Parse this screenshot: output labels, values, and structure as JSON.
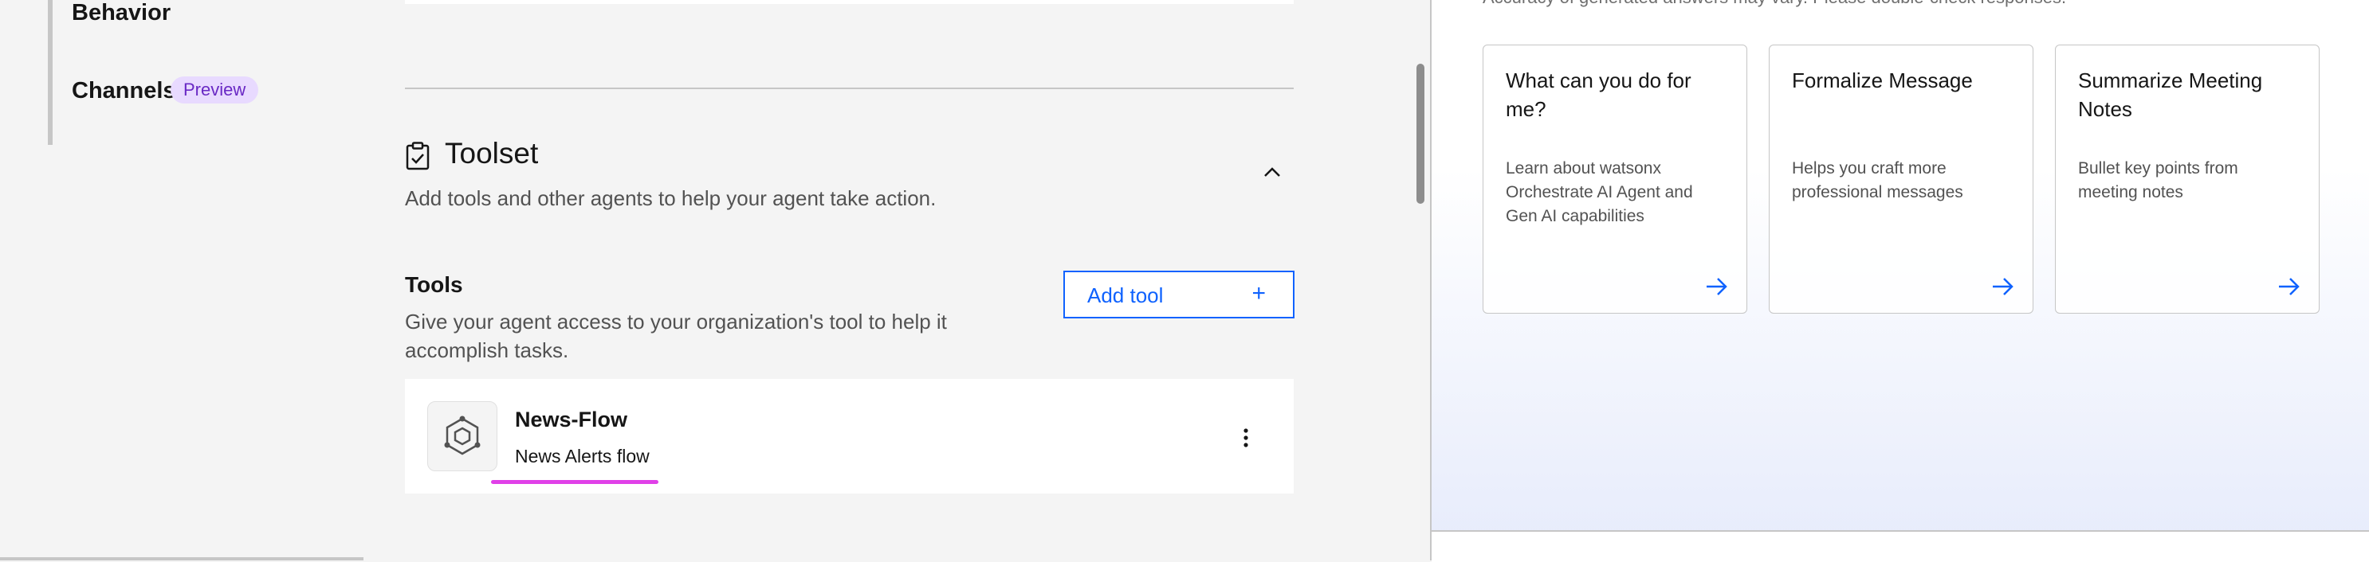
{
  "sidebar": {
    "items": [
      {
        "label": "Behavior"
      },
      {
        "label": "Channels",
        "tag": "Preview"
      }
    ]
  },
  "toolset": {
    "title": "Toolset",
    "description": "Add tools and other agents to help your agent take action.",
    "tools": {
      "title": "Tools",
      "description": "Give your agent access to your organization's tool to help it accomplish tasks.",
      "add_button": {
        "label": "Add tool",
        "icon": "+"
      },
      "items": [
        {
          "name": "News-Flow",
          "description": "News Alerts flow",
          "icon": "flow-hexagon-icon"
        }
      ]
    }
  },
  "preview_panel": {
    "disclaimer": "Accuracy of generated answers may vary. Please double-check responses.",
    "prompts": [
      {
        "title": "What can you do for me?",
        "description": "Learn about watsonx Orchestrate AI Agent and Gen AI capabilities"
      },
      {
        "title": "Formalize Message",
        "description": "Helps you craft more professional messages"
      },
      {
        "title": "Summarize Meeting Notes",
        "description": "Bullet key points from meeting notes"
      }
    ]
  },
  "colors": {
    "accent": "#0f62fe",
    "tag_bg": "#e8daff",
    "tag_text": "#6929c4",
    "highlight": "#e040e8"
  }
}
